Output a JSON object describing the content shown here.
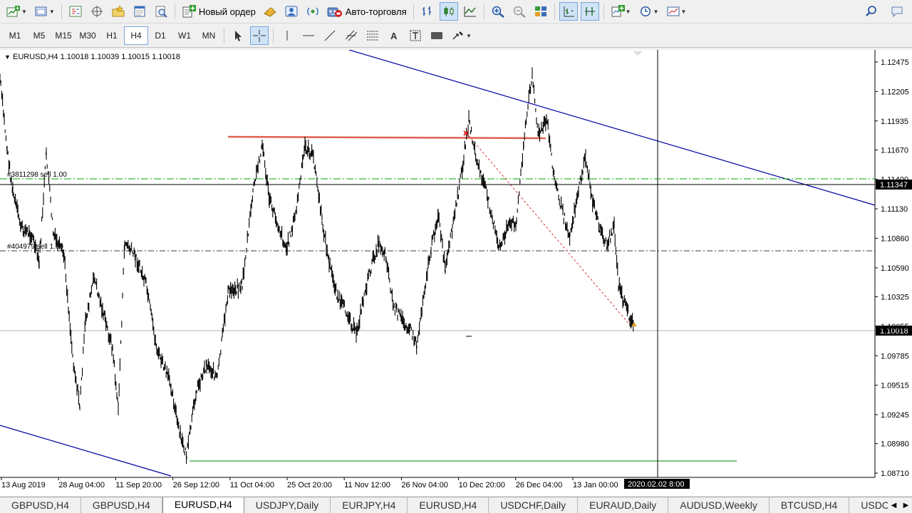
{
  "toolbar": {
    "new_order_label": "Новый ордер",
    "auto_trading_label": "Авто-торговля"
  },
  "timeframes": [
    "M1",
    "M5",
    "M15",
    "M30",
    "H1",
    "H4",
    "D1",
    "W1",
    "MN"
  ],
  "active_timeframe": "H4",
  "chart": {
    "header": "EURUSD,H4  1.10018 1.10039 1.10015 1.10018",
    "order_labels": [
      "#3811298 sell 1.00",
      "#404979 sell 1.00"
    ],
    "price_ticks": [
      "1.12475",
      "1.12205",
      "1.11935",
      "1.11670",
      "1.11400",
      "1.11130",
      "1.10860",
      "1.10590",
      "1.10325",
      "1.10055",
      "1.09785",
      "1.09515",
      "1.09245",
      "1.08980",
      "1.08710"
    ],
    "price_values": [
      1.12475,
      1.12205,
      1.11935,
      1.1167,
      1.114,
      1.1113,
      1.1086,
      1.1059,
      1.10325,
      1.10055,
      1.09785,
      1.09515,
      1.09245,
      1.0898,
      1.0871
    ],
    "crosshair_price": "1.11347",
    "current_price": "1.10018",
    "time_ticks": [
      "13 Aug 2019",
      "28 Aug 04:00",
      "11 Sep 20:00",
      "26 Sep 12:00",
      "11 Oct 04:00",
      "25 Oct 20:00",
      "11 Nov 12:00",
      "26 Nov 04:00",
      "10 Dec 20:00",
      "26 Dec 04:00",
      "13 Jan 00:00"
    ],
    "crosshair_time": "2020.02.02 8:00",
    "colors": {
      "background": "#ffffff",
      "candles": "#000000",
      "trendline": "#0000a0",
      "resistance": "#e06050",
      "support": "#80c080",
      "order_line_green": "#00aa00",
      "order_line_black": "#000000",
      "crosshair": "#000000"
    }
  },
  "tabs": [
    "GBPUSD,H4",
    "GBPUSD,H4",
    "EURUSD,H4",
    "USDJPY,Daily",
    "EURJPY,H4",
    "EURUSD,H4",
    "USDCHF,Daily",
    "EURAUD,Daily",
    "AUDUSD,Weekly",
    "BTCUSD,H4",
    "USDCAD,Daily"
  ],
  "active_tab": 2
}
